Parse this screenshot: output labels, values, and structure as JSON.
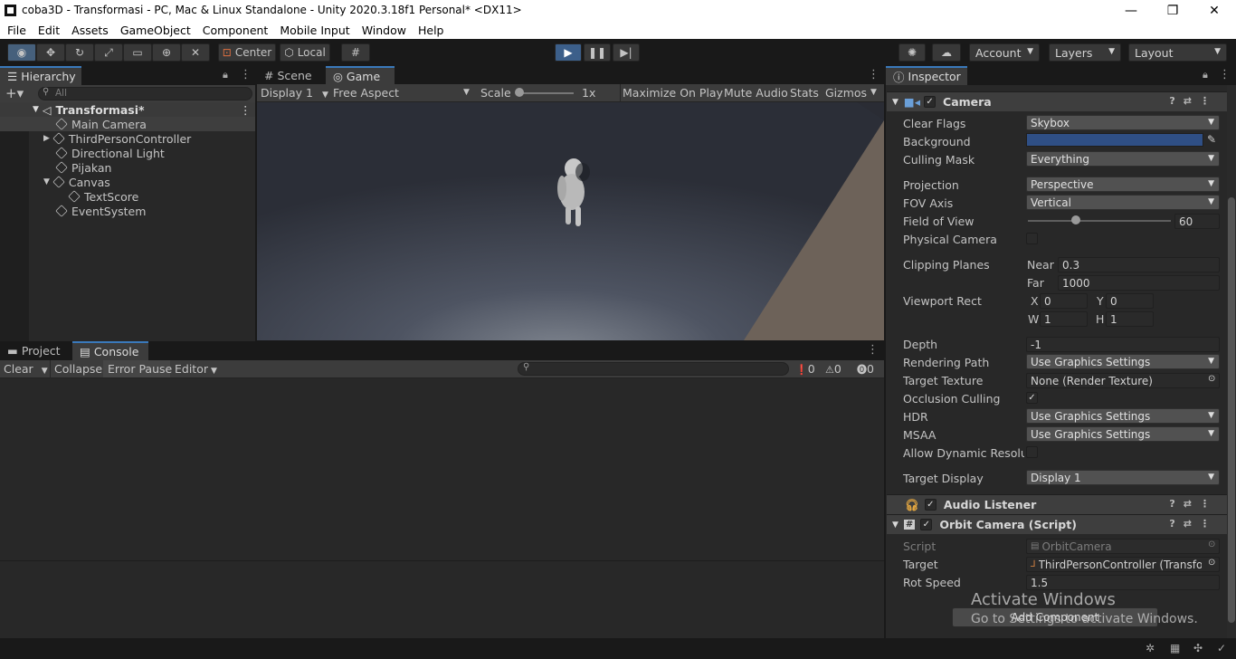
{
  "window": {
    "title": "coba3D - Transformasi - PC, Mac & Linux Standalone - Unity 2020.3.18f1 Personal* <DX11>",
    "minimize": "—",
    "restore": "❐",
    "close": "✕"
  },
  "menu": [
    "File",
    "Edit",
    "Assets",
    "GameObject",
    "Component",
    "Mobile Input",
    "Window",
    "Help"
  ],
  "toolbar": {
    "pivot_label": "Center",
    "space_label": "Local",
    "account_label": "Account",
    "layers_label": "Layers",
    "layout_label": "Layout"
  },
  "hierarchy": {
    "tab_label": "Hierarchy",
    "search_placeholder": "All",
    "scene_name": "Transformasi*",
    "items": [
      {
        "label": "Main Camera"
      },
      {
        "label": "ThirdPersonController"
      },
      {
        "label": "Directional Light"
      },
      {
        "label": "Pijakan"
      },
      {
        "label": "Canvas"
      },
      {
        "label": "TextScore"
      },
      {
        "label": "EventSystem"
      }
    ]
  },
  "game": {
    "tab_scene": "Scene",
    "tab_game": "Game",
    "display": "Display 1",
    "aspect": "Free Aspect",
    "scale_label": "Scale",
    "scale_value": "1x",
    "maximize": "Maximize On Play",
    "mute": "Mute Audio",
    "stats": "Stats",
    "gizmos": "Gizmos"
  },
  "console": {
    "tab_project": "Project",
    "tab_console": "Console",
    "clear": "Clear",
    "collapse": "Collapse",
    "error_pause": "Error Pause",
    "editor": "Editor",
    "count_log": "0",
    "count_warn": "0",
    "count_error": "0"
  },
  "inspector": {
    "tab_label": "Inspector",
    "camera_header": "Camera",
    "fields": {
      "clear_flags_label": "Clear Flags",
      "clear_flags_value": "Skybox",
      "background_label": "Background",
      "culling_mask_label": "Culling Mask",
      "culling_mask_value": "Everything",
      "projection_label": "Projection",
      "projection_value": "Perspective",
      "fov_axis_label": "FOV Axis",
      "fov_axis_value": "Vertical",
      "fov_label": "Field of View",
      "fov_value": "60",
      "physical_label": "Physical Camera",
      "clipping_label": "Clipping Planes",
      "near_label": "Near",
      "near_value": "0.3",
      "far_label": "Far",
      "far_value": "1000",
      "viewport_label": "Viewport Rect",
      "x_label": "X",
      "x_value": "0",
      "y_label": "Y",
      "y_value": "0",
      "w_label": "W",
      "w_value": "1",
      "h_label": "H",
      "h_value": "1",
      "depth_label": "Depth",
      "depth_value": "-1",
      "rendering_label": "Rendering Path",
      "rendering_value": "Use Graphics Settings",
      "target_texture_label": "Target Texture",
      "target_texture_value": "None (Render Texture)",
      "occlusion_label": "Occlusion Culling",
      "hdr_label": "HDR",
      "hdr_value": "Use Graphics Settings",
      "msaa_label": "MSAA",
      "msaa_value": "Use Graphics Settings",
      "dynres_label": "Allow Dynamic Resolutic",
      "target_display_label": "Target Display",
      "target_display_value": "Display 1"
    },
    "audio_header": "Audio Listener",
    "orbit_header": "Orbit Camera (Script)",
    "orbit": {
      "script_label": "Script",
      "script_value": "OrbitCamera",
      "target_label": "Target",
      "target_value": "ThirdPersonController (Transforr",
      "rot_label": "Rot Speed",
      "rot_value": "1.5"
    },
    "add_component": "Add Component",
    "watermark_1": "Activate Windows",
    "watermark_2": "Go to Settings to activate Windows."
  },
  "colors": {
    "accent": "#3a79bb",
    "background_color": "#2f4f85",
    "play_active": "#3c5f8a"
  }
}
